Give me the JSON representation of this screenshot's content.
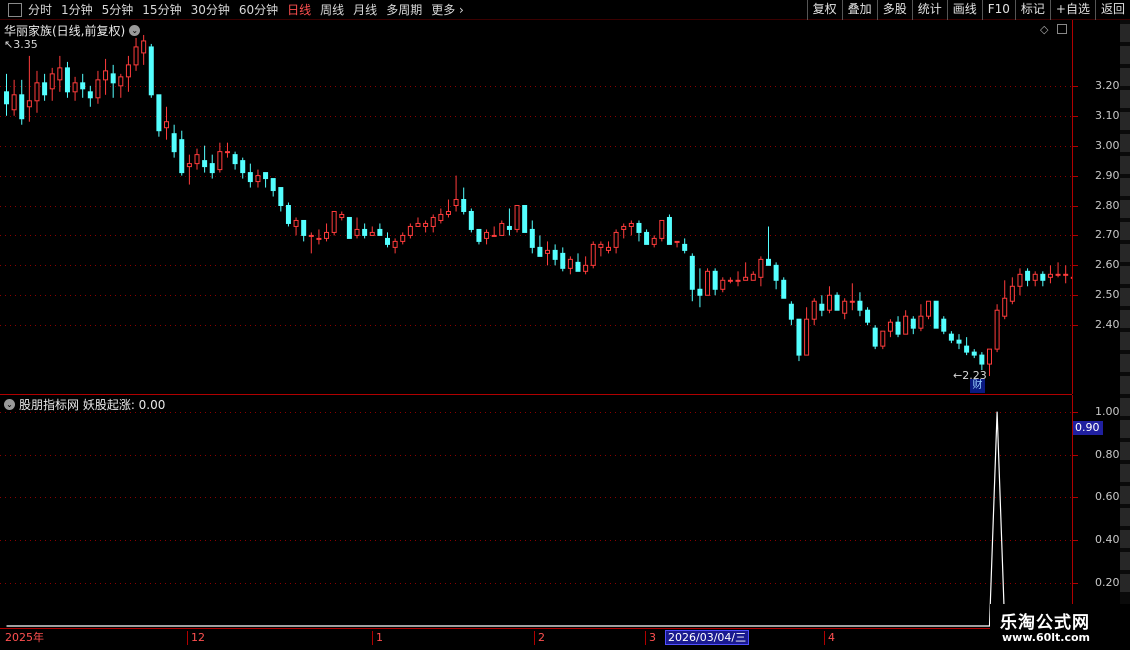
{
  "toolbar": {
    "periods": [
      "分时",
      "1分钟",
      "5分钟",
      "15分钟",
      "30分钟",
      "60分钟",
      "日线",
      "周线",
      "月线",
      "多周期",
      "更多"
    ],
    "active_period": "日线",
    "buttons": [
      "复权",
      "叠加",
      "多股",
      "统计",
      "画线",
      "F10",
      "标记",
      "+自选",
      "返回"
    ]
  },
  "main_panel": {
    "title": "华丽家族(日线,前复权)",
    "high_label": "3.35",
    "low_label": "2.23",
    "badge": "财"
  },
  "indicator_panel": {
    "title": "股朋指标网 妖股起涨: 0.00",
    "value_badge": "0.90"
  },
  "price_axis": [
    "3.20",
    "3.10",
    "3.00",
    "2.90",
    "2.80",
    "2.70",
    "2.60",
    "2.50",
    "2.40"
  ],
  "indicator_axis": [
    "1.00",
    "0.80",
    "0.60",
    "0.40",
    "0.20"
  ],
  "time_axis": {
    "labels": [
      "2025年",
      "12",
      "1",
      "2",
      "3",
      "4"
    ],
    "crosshair_date": "2026/03/04/三"
  },
  "watermark": {
    "line1": "乐淘公式网",
    "line2": "www.60lt.com"
  },
  "colors": {
    "up": "#ff3c3c",
    "down": "#54ffff",
    "grid": "#8b0000",
    "axis": "#b00000",
    "active_tab": "#ff5050"
  },
  "chart_data": [
    {
      "type": "candlestick",
      "title": "华丽家族(日线,前复权)",
      "y_axis_ticks": [
        3.2,
        3.1,
        3.0,
        2.9,
        2.8,
        2.7,
        2.6,
        2.5,
        2.4
      ],
      "ylim": [
        2.17,
        3.42
      ],
      "marked_high": 3.35,
      "marked_low": 2.23,
      "ohlc": [
        [
          3.18,
          3.24,
          3.1,
          3.14
        ],
        [
          3.12,
          3.22,
          3.1,
          3.17
        ],
        [
          3.17,
          3.22,
          3.07,
          3.09
        ],
        [
          3.13,
          3.3,
          3.08,
          3.15
        ],
        [
          3.15,
          3.25,
          3.11,
          3.21
        ],
        [
          3.21,
          3.24,
          3.15,
          3.17
        ],
        [
          3.19,
          3.26,
          3.15,
          3.24
        ],
        [
          3.22,
          3.3,
          3.18,
          3.26
        ],
        [
          3.26,
          3.28,
          3.16,
          3.18
        ],
        [
          3.18,
          3.23,
          3.15,
          3.21
        ],
        [
          3.21,
          3.24,
          3.16,
          3.19
        ],
        [
          3.18,
          3.2,
          3.13,
          3.16
        ],
        [
          3.16,
          3.25,
          3.14,
          3.22
        ],
        [
          3.22,
          3.29,
          3.17,
          3.25
        ],
        [
          3.24,
          3.27,
          3.16,
          3.21
        ],
        [
          3.2,
          3.24,
          3.16,
          3.23
        ],
        [
          3.23,
          3.3,
          3.18,
          3.27
        ],
        [
          3.27,
          3.36,
          3.25,
          3.33
        ],
        [
          3.31,
          3.37,
          3.27,
          3.35
        ],
        [
          3.33,
          3.34,
          3.16,
          3.17
        ],
        [
          3.17,
          3.17,
          3.03,
          3.05
        ],
        [
          3.06,
          3.13,
          3.02,
          3.08
        ],
        [
          3.04,
          3.07,
          2.96,
          2.98
        ],
        [
          3.02,
          3.05,
          2.9,
          2.91
        ],
        [
          2.93,
          2.97,
          2.87,
          2.94
        ],
        [
          2.94,
          2.99,
          2.92,
          2.97
        ],
        [
          2.95,
          3.0,
          2.91,
          2.93
        ],
        [
          2.94,
          2.97,
          2.89,
          2.91
        ],
        [
          2.92,
          3.01,
          2.91,
          2.98
        ],
        [
          2.98,
          3.01,
          2.96,
          2.98
        ],
        [
          2.97,
          2.98,
          2.92,
          2.94
        ],
        [
          2.95,
          2.96,
          2.89,
          2.91
        ],
        [
          2.91,
          2.94,
          2.86,
          2.88
        ],
        [
          2.88,
          2.92,
          2.86,
          2.9
        ],
        [
          2.91,
          2.91,
          2.86,
          2.89
        ],
        [
          2.89,
          2.89,
          2.83,
          2.85
        ],
        [
          2.86,
          2.86,
          2.78,
          2.8
        ],
        [
          2.8,
          2.81,
          2.73,
          2.74
        ],
        [
          2.73,
          2.76,
          2.7,
          2.75
        ],
        [
          2.75,
          2.75,
          2.68,
          2.7
        ],
        [
          2.7,
          2.71,
          2.64,
          2.7
        ],
        [
          2.69,
          2.72,
          2.67,
          2.69
        ],
        [
          2.69,
          2.74,
          2.68,
          2.71
        ],
        [
          2.71,
          2.78,
          2.7,
          2.78
        ],
        [
          2.76,
          2.78,
          2.75,
          2.77
        ],
        [
          2.76,
          2.76,
          2.69,
          2.69
        ],
        [
          2.7,
          2.76,
          2.69,
          2.72
        ],
        [
          2.72,
          2.74,
          2.69,
          2.7
        ],
        [
          2.7,
          2.73,
          2.7,
          2.71
        ],
        [
          2.72,
          2.74,
          2.7,
          2.7
        ],
        [
          2.69,
          2.71,
          2.66,
          2.67
        ],
        [
          2.66,
          2.69,
          2.64,
          2.68
        ],
        [
          2.68,
          2.71,
          2.67,
          2.7
        ],
        [
          2.7,
          2.74,
          2.69,
          2.73
        ],
        [
          2.73,
          2.76,
          2.73,
          2.74
        ],
        [
          2.73,
          2.75,
          2.71,
          2.74
        ],
        [
          2.73,
          2.77,
          2.71,
          2.76
        ],
        [
          2.75,
          2.79,
          2.74,
          2.77
        ],
        [
          2.77,
          2.82,
          2.76,
          2.78
        ],
        [
          2.8,
          2.9,
          2.78,
          2.82
        ],
        [
          2.82,
          2.86,
          2.77,
          2.78
        ],
        [
          2.78,
          2.79,
          2.71,
          2.72
        ],
        [
          2.72,
          2.72,
          2.67,
          2.68
        ],
        [
          2.69,
          2.72,
          2.67,
          2.71
        ],
        [
          2.7,
          2.73,
          2.7,
          2.7
        ],
        [
          2.7,
          2.75,
          2.7,
          2.74
        ],
        [
          2.73,
          2.79,
          2.7,
          2.72
        ],
        [
          2.72,
          2.8,
          2.71,
          2.8
        ],
        [
          2.8,
          2.8,
          2.71,
          2.71
        ],
        [
          2.72,
          2.75,
          2.64,
          2.66
        ],
        [
          2.66,
          2.7,
          2.63,
          2.63
        ],
        [
          2.64,
          2.68,
          2.6,
          2.65
        ],
        [
          2.65,
          2.67,
          2.6,
          2.62
        ],
        [
          2.64,
          2.66,
          2.58,
          2.59
        ],
        [
          2.59,
          2.63,
          2.57,
          2.62
        ],
        [
          2.61,
          2.64,
          2.58,
          2.58
        ],
        [
          2.58,
          2.63,
          2.57,
          2.6
        ],
        [
          2.6,
          2.68,
          2.59,
          2.67
        ],
        [
          2.66,
          2.68,
          2.63,
          2.67
        ],
        [
          2.65,
          2.68,
          2.64,
          2.66
        ],
        [
          2.66,
          2.72,
          2.64,
          2.71
        ],
        [
          2.72,
          2.74,
          2.69,
          2.73
        ],
        [
          2.73,
          2.75,
          2.7,
          2.74
        ],
        [
          2.74,
          2.75,
          2.68,
          2.71
        ],
        [
          2.71,
          2.72,
          2.67,
          2.67
        ],
        [
          2.67,
          2.7,
          2.66,
          2.69
        ],
        [
          2.69,
          2.75,
          2.68,
          2.75
        ],
        [
          2.76,
          2.77,
          2.67,
          2.67
        ],
        [
          2.68,
          2.68,
          2.66,
          2.68
        ],
        [
          2.67,
          2.69,
          2.64,
          2.65
        ],
        [
          2.63,
          2.64,
          2.48,
          2.52
        ],
        [
          2.52,
          2.59,
          2.46,
          2.5
        ],
        [
          2.5,
          2.59,
          2.5,
          2.58
        ],
        [
          2.58,
          2.59,
          2.5,
          2.52
        ],
        [
          2.52,
          2.56,
          2.51,
          2.55
        ],
        [
          2.55,
          2.56,
          2.54,
          2.55
        ],
        [
          2.55,
          2.58,
          2.53,
          2.55
        ],
        [
          2.55,
          2.61,
          2.55,
          2.56
        ],
        [
          2.55,
          2.58,
          2.55,
          2.57
        ],
        [
          2.56,
          2.63,
          2.53,
          2.62
        ],
        [
          2.62,
          2.73,
          2.6,
          2.6
        ],
        [
          2.6,
          2.61,
          2.52,
          2.55
        ],
        [
          2.55,
          2.56,
          2.49,
          2.49
        ],
        [
          2.47,
          2.48,
          2.4,
          2.42
        ],
        [
          2.42,
          2.42,
          2.28,
          2.3
        ],
        [
          2.3,
          2.46,
          2.3,
          2.42
        ],
        [
          2.42,
          2.49,
          2.4,
          2.48
        ],
        [
          2.47,
          2.5,
          2.43,
          2.45
        ],
        [
          2.45,
          2.53,
          2.44,
          2.5
        ],
        [
          2.5,
          2.51,
          2.45,
          2.45
        ],
        [
          2.44,
          2.49,
          2.42,
          2.48
        ],
        [
          2.48,
          2.54,
          2.45,
          2.48
        ],
        [
          2.48,
          2.51,
          2.43,
          2.45
        ],
        [
          2.45,
          2.46,
          2.4,
          2.41
        ],
        [
          2.39,
          2.4,
          2.32,
          2.33
        ],
        [
          2.33,
          2.38,
          2.32,
          2.38
        ],
        [
          2.38,
          2.42,
          2.36,
          2.41
        ],
        [
          2.41,
          2.43,
          2.36,
          2.37
        ],
        [
          2.37,
          2.45,
          2.37,
          2.43
        ],
        [
          2.42,
          2.43,
          2.37,
          2.39
        ],
        [
          2.39,
          2.47,
          2.38,
          2.43
        ],
        [
          2.43,
          2.48,
          2.42,
          2.48
        ],
        [
          2.48,
          2.48,
          2.39,
          2.39
        ],
        [
          2.42,
          2.43,
          2.37,
          2.38
        ],
        [
          2.37,
          2.38,
          2.34,
          2.35
        ],
        [
          2.35,
          2.37,
          2.32,
          2.34
        ],
        [
          2.33,
          2.36,
          2.3,
          2.31
        ],
        [
          2.31,
          2.32,
          2.29,
          2.3
        ],
        [
          2.3,
          2.31,
          2.25,
          2.27
        ],
        [
          2.27,
          2.32,
          2.23,
          2.32
        ],
        [
          2.32,
          2.47,
          2.31,
          2.45
        ],
        [
          2.43,
          2.55,
          2.42,
          2.49
        ],
        [
          2.48,
          2.56,
          2.47,
          2.53
        ],
        [
          2.53,
          2.59,
          2.5,
          2.57
        ],
        [
          2.58,
          2.59,
          2.53,
          2.55
        ],
        [
          2.55,
          2.58,
          2.53,
          2.57
        ],
        [
          2.57,
          2.58,
          2.53,
          2.55
        ],
        [
          2.56,
          2.6,
          2.54,
          2.57
        ],
        [
          2.57,
          2.61,
          2.56,
          2.57
        ],
        [
          2.57,
          2.6,
          2.54,
          2.57
        ],
        [
          2.56,
          2.58,
          2.53,
          2.56
        ],
        [
          2.56,
          2.57,
          2.52,
          2.53
        ]
      ]
    },
    {
      "type": "line",
      "title": "妖股起涨",
      "ylim": [
        0,
        1.05
      ],
      "y_axis_ticks": [
        1.0,
        0.8,
        0.6,
        0.4,
        0.2
      ],
      "signal_bar_index": 130,
      "signal_value": 1.0,
      "baseline_value": 0
    }
  ]
}
